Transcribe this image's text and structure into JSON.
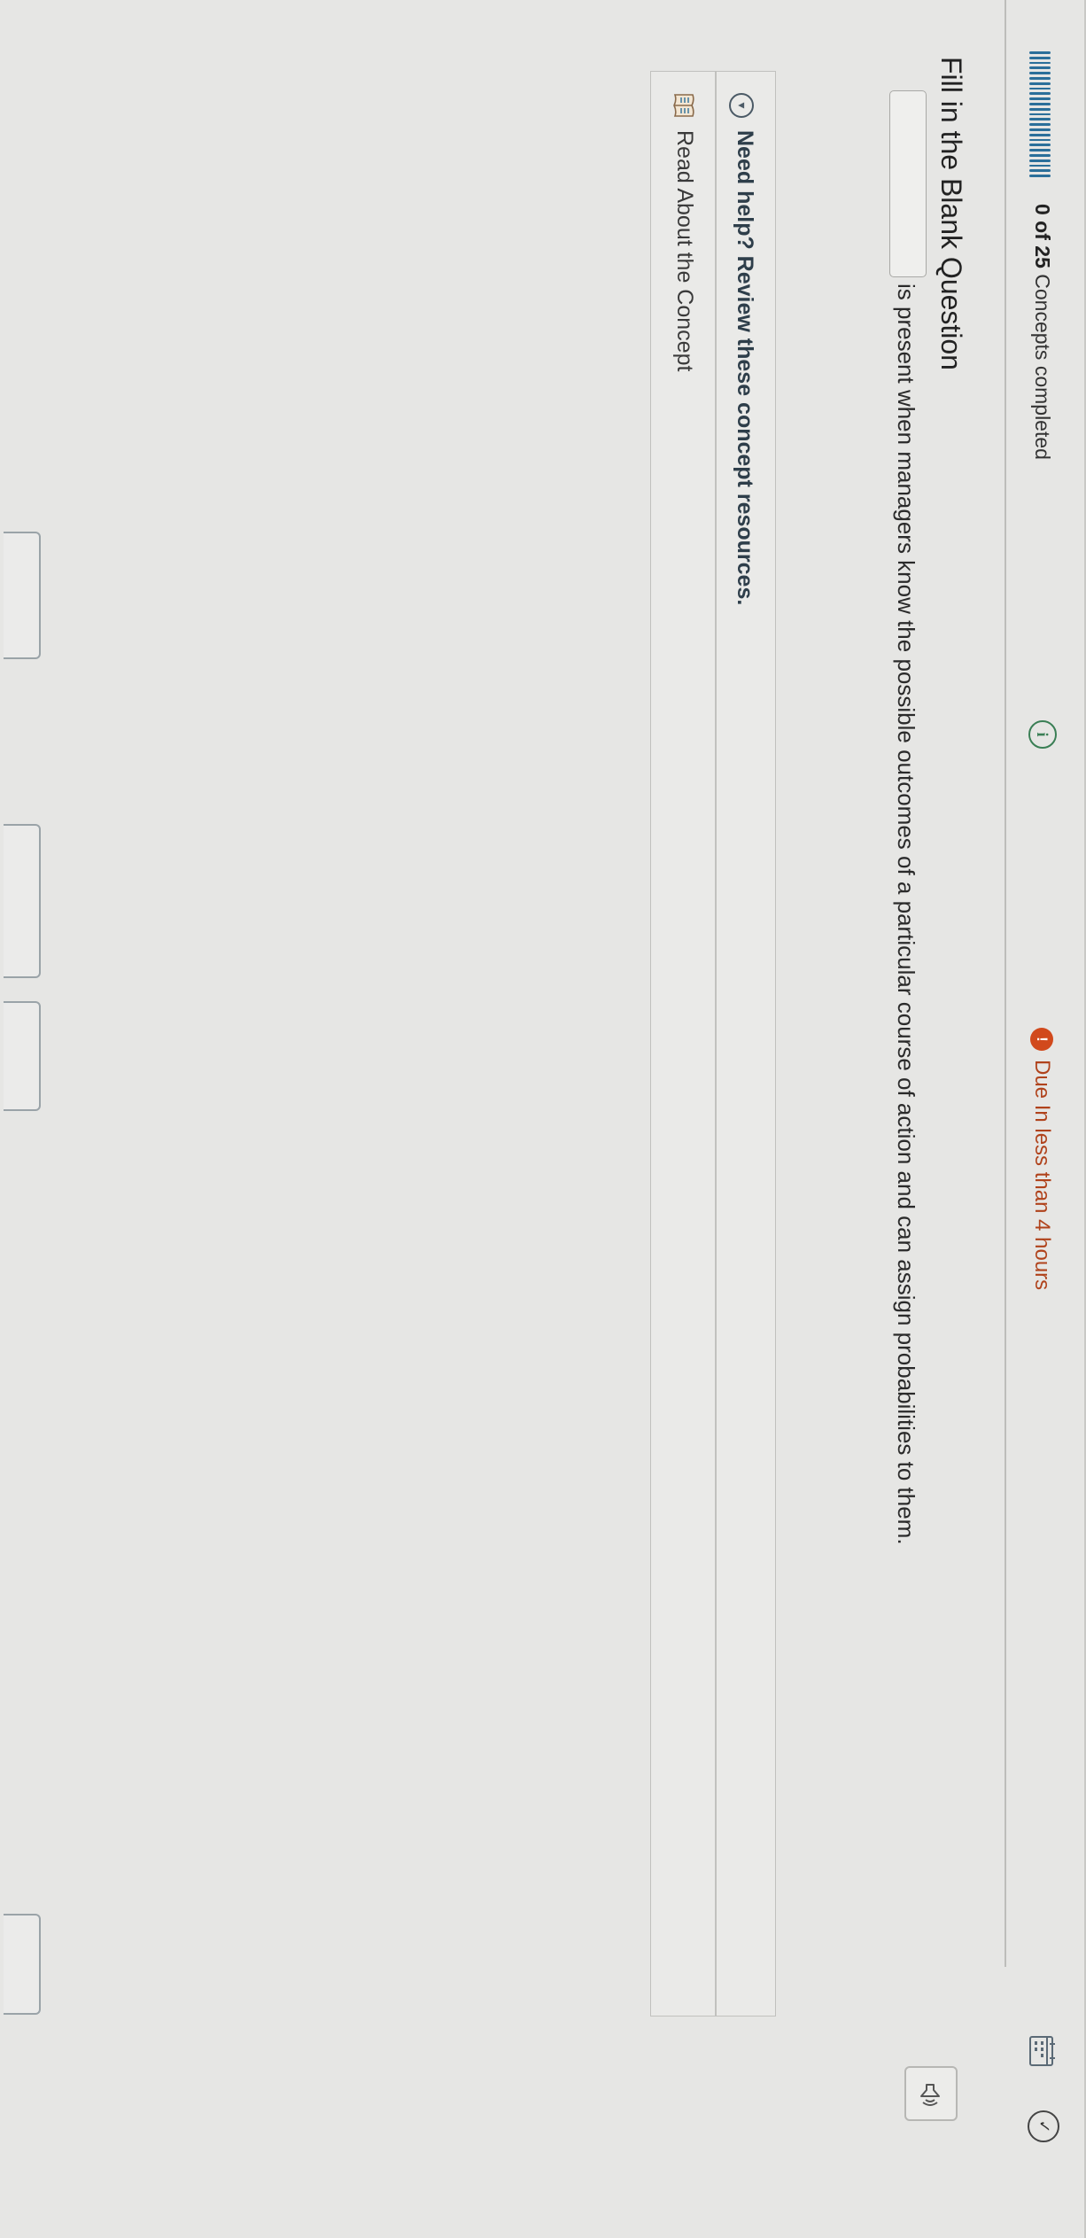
{
  "header": {
    "progress_segments": 25,
    "progress_completed": 0,
    "concepts_count": "0 of 25",
    "concepts_label": "Concepts completed",
    "due_text": "Due In less than 4 hours",
    "info_icon": "info-icon",
    "due_icon": "alert-icon",
    "calendar_icon": "calendar-icon",
    "check_icon": "check-circle-icon"
  },
  "question": {
    "title": "Fill in the Blank Question",
    "blank_value": "",
    "text": "is present when managers know the possible outcomes of a particular course of action and can assign probabilities to them.",
    "audio_icon": "speaker-icon"
  },
  "help": {
    "heading": "Need help? Review these concept resources.",
    "resource_link": "Read About the Concept",
    "chevron_icon": "chevron-down-icon",
    "book_icon": "book-icon"
  },
  "colors": {
    "accent": "#2b6f9a",
    "due": "#b0431c",
    "info": "#3a7f55"
  }
}
